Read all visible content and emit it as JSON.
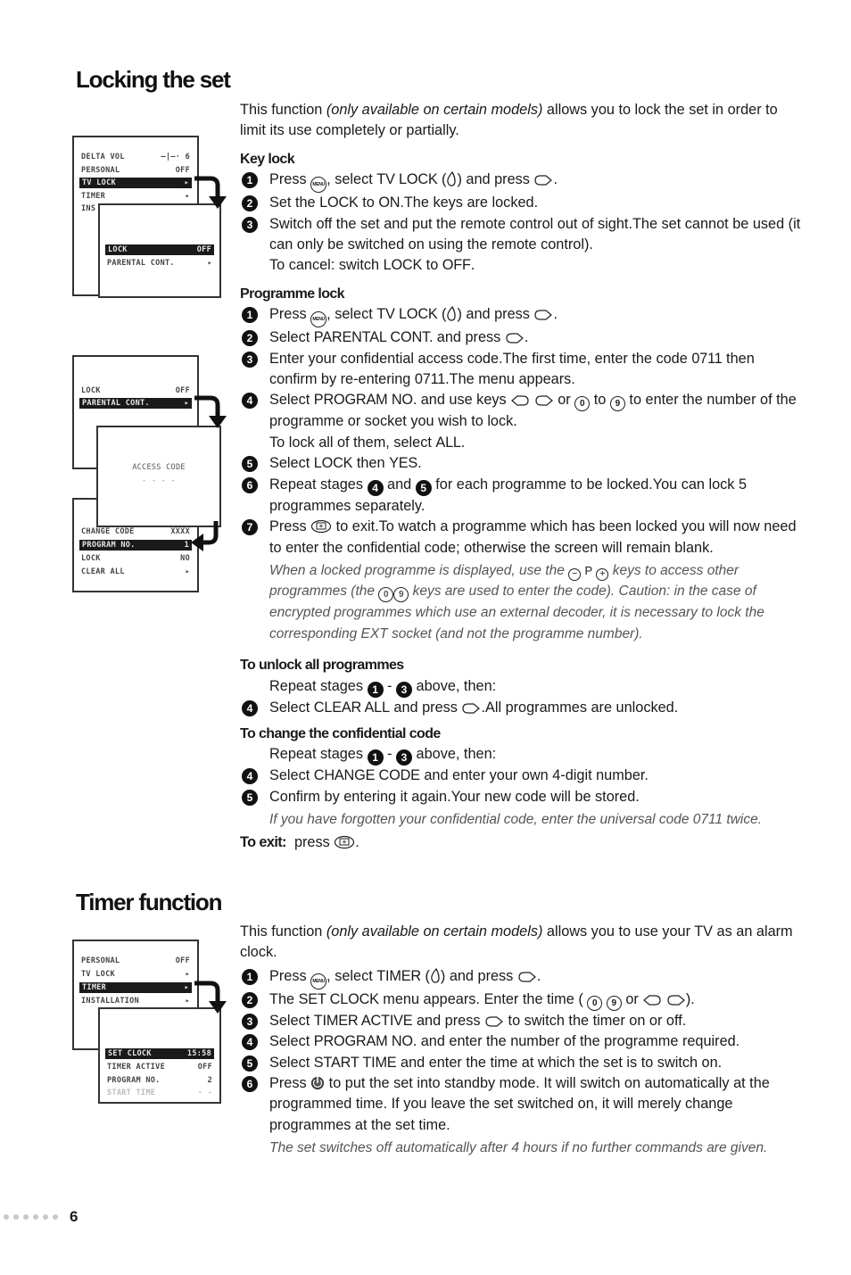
{
  "page_number": "6",
  "icons": {
    "menu_key": "menu-button-icon",
    "tvlock_symbol": "drop-icon",
    "right_cursor": "cursor-right-icon",
    "left_cursor": "cursor-left-icon",
    "digit0": "0",
    "digit9": "9",
    "exit_key": "exit-button-icon",
    "minus": "−",
    "plus": "+",
    "p_label": "P",
    "standby": "standby-button-icon"
  },
  "locking": {
    "title": "Locking the set",
    "intro_pre": "This function ",
    "intro_italic": "(only available on certain models)",
    "intro_post": " allows you to lock the set in order to limit its use completely or partially.",
    "key_lock": {
      "heading": "Key lock",
      "s1": {
        "n": "1",
        "a": "Press ",
        "b": ", select ",
        "c": "TV LOCK",
        "d": " (",
        "e": ") and press ",
        "f": "."
      },
      "s2": {
        "n": "2",
        "a": "Set the ",
        "b": "LOCK",
        "c": " to ",
        "d": "ON",
        ".e": "",
        "e": ".The keys are locked."
      },
      "s3": {
        "n": "3",
        "a": "Switch off the set and put the remote control out of sight.The set cannot be used (it can only be switched on using the remote control).",
        "b": "To cancel: switch ",
        "c": "LOCK",
        "d": " to ",
        "e": "OFF",
        "f": "."
      }
    },
    "programme_lock": {
      "heading": "Programme lock",
      "s1": {
        "n": "1",
        "a": "Press ",
        "b": ", select ",
        "c": "TV LOCK",
        "d": " (",
        "e": ") and press ",
        "f": "."
      },
      "s2": {
        "n": "2",
        "a": "Select ",
        "b": "PARENTAL CONT.",
        "c": " and press ",
        "d": "."
      },
      "s3": {
        "n": "3",
        "a": "Enter your confidential access code.The first time, enter the code ",
        "b": "0711",
        "c": " then confirm by re-entering ",
        "d": "0711",
        ".e": "",
        "e": ".The menu appears."
      },
      "s4": {
        "n": "4",
        "a": "Select ",
        "b": "PROGRAM NO.",
        "c": " and use keys ",
        "d": " or ",
        "e": " to ",
        "f": " to enter the number of the programme or socket you wish to lock.",
        "g": "To lock all of them, select ",
        "h": "ALL",
        "i": "."
      },
      "s5": {
        "n": "5",
        "a": "Select ",
        "b": "LOCK",
        "c": " then ",
        "d": "YES",
        "e": "."
      },
      "s6": {
        "n": "6",
        "a": "Repeat stages ",
        "b": "4",
        "c": " and ",
        "d": "5",
        "e": " for each programme to be locked.You can lock 5 programmes separately."
      },
      "s7": {
        "n": "7",
        "a": "Press ",
        "b": " to exit.To watch a programme which has been locked you will now need to enter the confidential code; otherwise the screen will remain blank."
      },
      "note": {
        "a": "When a locked programme is displayed, use the ",
        "b": " keys to access other programmes (the ",
        "c": " keys are used to enter the code). Caution: in the case of encrypted programmes which use an external decoder, it is necessary to lock the corresponding EXT socket (and not the programme number)."
      }
    },
    "unlock_all": {
      "heading": "To unlock all programmes",
      "repeat": {
        "a": "Repeat stages ",
        "b": "1",
        "c": " - ",
        "d": "3",
        "e": " above, then:"
      },
      "s4": {
        "n": "4",
        "a": "Select ",
        "b": "CLEAR ALL",
        "c": " and press ",
        "d": ".All programmes are unlocked."
      }
    },
    "change_code": {
      "heading": "To change the confidential code",
      "repeat": {
        "a": "Repeat stages ",
        "b": "1",
        "c": " - ",
        "d": "3",
        "e": " above, then:"
      },
      "s4": {
        "n": "4",
        "a": "Select ",
        "b": "CHANGE CODE",
        "c": " and enter your own 4-digit number."
      },
      "s5": {
        "n": "5",
        "a": "Confirm by entering it again.Your new code will be stored."
      },
      "note": "If you have forgotten your confidential code, enter the universal code 0711 twice."
    },
    "exit": {
      "label": "To exit:",
      "text": "press ",
      "end": "."
    }
  },
  "timer": {
    "title": "Timer function",
    "intro_pre": "This function ",
    "intro_italic": "(only available on certain models)",
    "intro_post": " allows you to use your TV as an alarm clock.",
    "s1": {
      "n": "1",
      "a": "Press ",
      "b": ", select ",
      "c": "TIMER",
      "d": " (",
      "e": ") and press ",
      "f": "."
    },
    "s2": {
      "n": "2",
      "a": "The ",
      "b": "SET CLOCK",
      "c": " menu appears. Enter the time ( ",
      "d": " or ",
      "e": ")."
    },
    "s3": {
      "n": "3",
      "a": "Select ",
      "b": "TIMER ACTIVE",
      "c": " and press ",
      "d": " to switch the timer on or off."
    },
    "s4": {
      "n": "4",
      "a": "Select ",
      "b": "PROGRAM NO.",
      "c": " and enter the number of the programme required."
    },
    "s5": {
      "n": "5",
      "a": "Select ",
      "b": "START TIME",
      "c": " and enter the time at which the set is to switch on."
    },
    "s6": {
      "n": "6",
      "a": "Press ",
      "b": " to put the set into standby mode. It will switch on automatically at the programmed time. If you leave the set switched on, it will merely change programmes at the set time."
    },
    "note": "The set switches off automatically after 4 hours if no further commands are given."
  },
  "diagrams": {
    "d1_main": [
      {
        "label": "DELTA VOL",
        "value": "—|—· 6"
      },
      {
        "label": "PERSONAL",
        "value": "OFF"
      },
      {
        "label": "TV LOCK",
        "value": "▸",
        "selected": true
      },
      {
        "label": "TIMER",
        "value": "▸"
      },
      {
        "label": "INS",
        "value": ""
      }
    ],
    "d1_sub": [
      {
        "label": "LOCK",
        "value": "OFF",
        "selected": true
      },
      {
        "label": "PARENTAL CONT.",
        "value": "▸"
      }
    ],
    "d2_main": [
      {
        "label": "LOCK",
        "value": "OFF"
      },
      {
        "label": "PARENTAL CONT.",
        "value": "▸",
        "selected": true
      }
    ],
    "d2_access": {
      "label": "ACCESS CODE",
      "value": "- - - -"
    },
    "d2_sub": [
      {
        "label": "CHANGE CODE",
        "value": "XXXX"
      },
      {
        "label": "PROGRAM NO.",
        "value": "1",
        "selected": true
      },
      {
        "label": "LOCK",
        "value": "NO"
      },
      {
        "label": "CLEAR ALL",
        "value": "▸"
      }
    ],
    "d3_main": [
      {
        "label": "PERSONAL",
        "value": "OFF"
      },
      {
        "label": "TV LOCK",
        "value": "▸"
      },
      {
        "label": "TIMER",
        "value": "▸",
        "selected": true
      },
      {
        "label": "INSTALLATION",
        "value": "▸"
      }
    ],
    "d3_sub": [
      {
        "label": "SET CLOCK",
        "value": "15:58",
        "selected": true
      },
      {
        "label": "TIMER ACTIVE",
        "value": "OFF"
      },
      {
        "label": "PROGRAM NO.",
        "value": "2"
      },
      {
        "label": "START TIME",
        "value": "- -",
        "faded": true
      }
    ]
  }
}
